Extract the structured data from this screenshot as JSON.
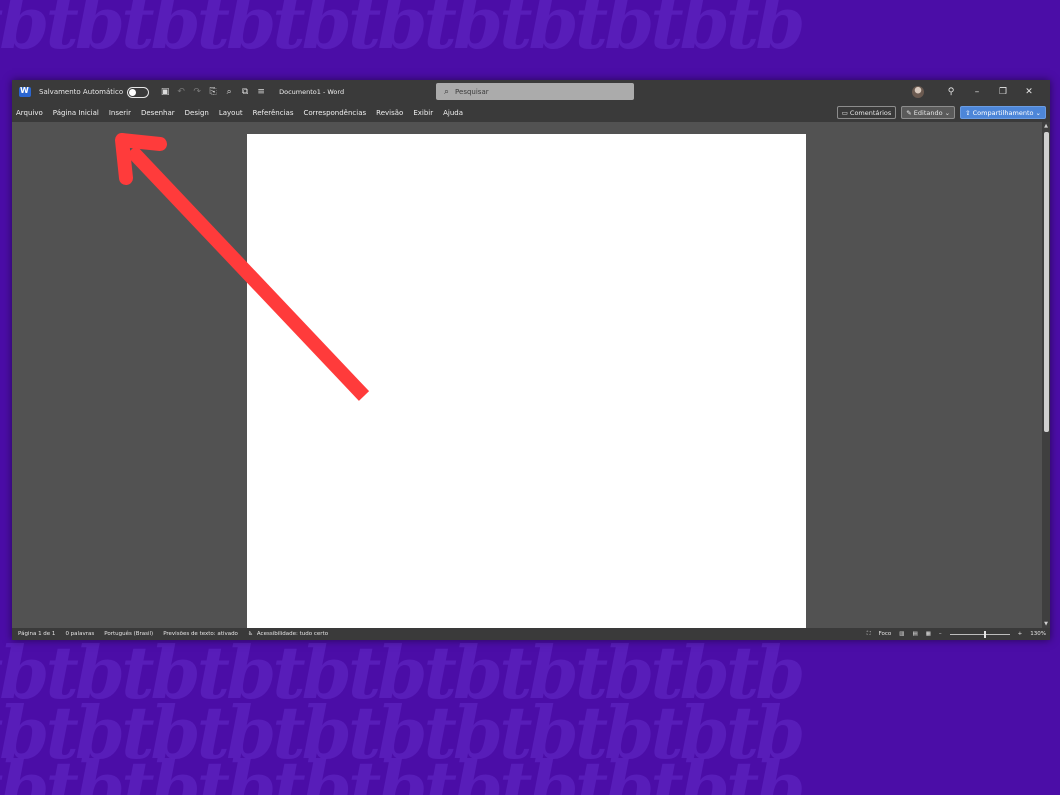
{
  "titlebar": {
    "autosave_label": "Salvamento Automático",
    "doc_title": "Documento1  -  Word",
    "search_placeholder": "Pesquisar"
  },
  "menu": {
    "items": [
      "Arquivo",
      "Página Inicial",
      "Inserir",
      "Desenhar",
      "Design",
      "Layout",
      "Referências",
      "Correspondências",
      "Revisão",
      "Exibir",
      "Ajuda"
    ],
    "comments_label": "Comentários",
    "editing_label": "Editando",
    "share_label": "Compartilhamento"
  },
  "statusbar": {
    "page": "Página 1 de 1",
    "words": "0 palavras",
    "language": "Português (Brasil)",
    "predictions": "Previsões de texto: ativado",
    "accessibility": "Acessibilidade: tudo certo",
    "focus": "Foco",
    "zoom": "130%"
  },
  "colors": {
    "background": "#4b0da7",
    "arrow": "#ff3b3b",
    "share_button": "#4d86d8"
  },
  "annotation": {
    "arrow_target": "Inserir"
  }
}
